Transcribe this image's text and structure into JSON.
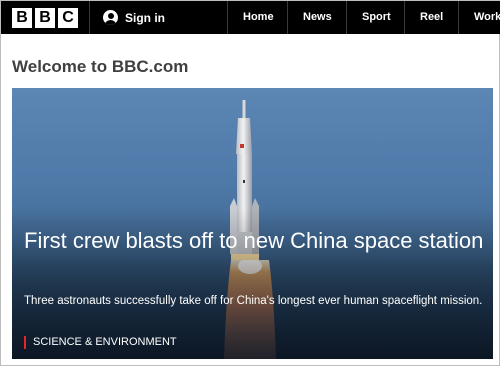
{
  "header": {
    "logo_letters": [
      "B",
      "B",
      "C"
    ],
    "signin_label": "Sign in",
    "nav": [
      "Home",
      "News",
      "Sport",
      "Reel",
      "Work"
    ]
  },
  "welcome_title": "Welcome to BBC.com",
  "hero": {
    "headline": "First crew blasts off to new China space station",
    "summary": "Three astronauts successfully take off for China's longest ever human spaceflight mission.",
    "tag": "SCIENCE & ENVIRONMENT",
    "tag_color": "#e8242b"
  },
  "colors": {
    "header_bg": "#000000",
    "sky": "#4e79a8",
    "welcome_text": "#404040"
  }
}
